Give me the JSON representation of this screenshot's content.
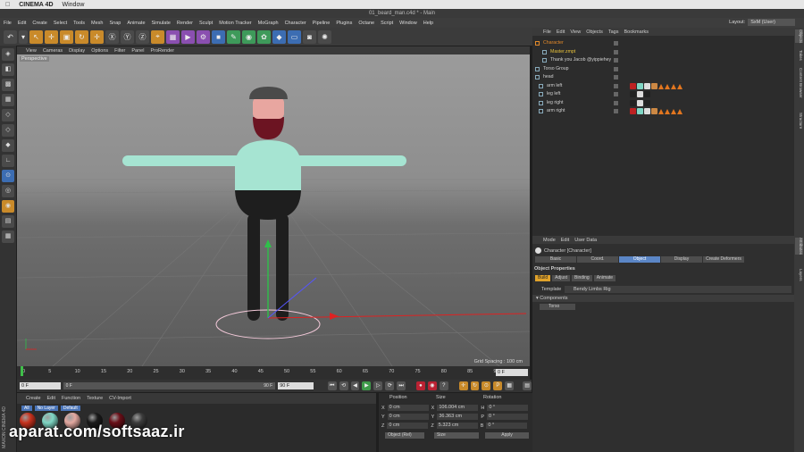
{
  "macbar": {
    "app": "CINEMA 4D",
    "menu": "Window"
  },
  "window_title": "01_beard_man.c4d * - Main",
  "menu": [
    "File",
    "Edit",
    "Create",
    "Select",
    "Tools",
    "Mesh",
    "Snap",
    "Animate",
    "Simulate",
    "Render",
    "Sculpt",
    "Motion Tracker",
    "MoGraph",
    "Character",
    "Pipeline",
    "Plugins",
    "Octane",
    "Script",
    "Window",
    "Help"
  ],
  "layout": {
    "label": "Layout:",
    "value": "SxM (User)"
  },
  "viewport": {
    "menu": [
      "View",
      "Cameras",
      "Display",
      "Options",
      "Filter",
      "Panel",
      "ProRender"
    ],
    "camera": "Perspective",
    "grid_spacing": "Grid Spacing : 100 cm"
  },
  "timeline": {
    "ticks": [
      "0",
      "5",
      "10",
      "15",
      "20",
      "25",
      "30",
      "35",
      "40",
      "45",
      "50",
      "55",
      "60",
      "65",
      "70",
      "75",
      "80",
      "85",
      "90"
    ],
    "current_frame": "0 F",
    "start": "0 F",
    "min": "0 F",
    "max": "90 F",
    "end": "90 F"
  },
  "materials": {
    "menu": [
      "Create",
      "Edit",
      "Function",
      "Texture",
      "CV-Import"
    ],
    "filters": [
      "All",
      "No Layer",
      "Default"
    ],
    "balls": [
      "#c8321e",
      "#7fd6c4",
      "#e3a8a0",
      "#1b1b1b",
      "#6a0f18",
      "#3c3c3c"
    ]
  },
  "coords": {
    "headers": [
      "Position",
      "Size",
      "Rotation"
    ],
    "rows": [
      {
        "axis": "X",
        "pos": "0 cm",
        "size_axis": "X",
        "size": "106.004 cm",
        "rot_axis": "H",
        "rot": "0 °"
      },
      {
        "axis": "Y",
        "pos": "0 cm",
        "size_axis": "Y",
        "size": "36.363 cm",
        "rot_axis": "P",
        "rot": "0 °"
      },
      {
        "axis": "Z",
        "pos": "0 cm",
        "size_axis": "Z",
        "size": "5.323 cm",
        "rot_axis": "B",
        "rot": "0 °"
      }
    ],
    "mode": "Object (Rel)",
    "size_mode": "Size",
    "apply": "Apply"
  },
  "watermark": "aparat.com/softsaaz.ir",
  "maxon": "MAXON CINEMA 4D",
  "object_manager": {
    "menu": [
      "File",
      "Edit",
      "View",
      "Objects",
      "Tags",
      "Bookmarks"
    ],
    "objects": [
      {
        "name": "Character",
        "color": "#e38a2a",
        "indent": 0,
        "tags": []
      },
      {
        "name": "Master.zmpt",
        "color": "#e8c23a",
        "indent": 2,
        "tags": []
      },
      {
        "name": "Thank you Jacob @yippiehey",
        "color": "#cfcfcf",
        "indent": 2,
        "tags": []
      },
      {
        "name": "Torso Group",
        "color": "#cfcfcf",
        "indent": 0,
        "tags": []
      },
      {
        "name": "head",
        "color": "#cfcfcf",
        "indent": 0,
        "tags": []
      },
      {
        "name": "arm left",
        "color": "#cfcfcf",
        "indent": 1,
        "tags": [
          "#b22",
          "#7fd6c4",
          "#ddd",
          "#c84",
          "tri",
          "tri",
          "tri",
          "tri"
        ]
      },
      {
        "name": "leg left",
        "color": "#cfcfcf",
        "indent": 1,
        "tags": [
          "#222",
          "#ddd",
          "#222"
        ]
      },
      {
        "name": "leg right",
        "color": "#cfcfcf",
        "indent": 1,
        "tags": [
          "#222",
          "#ddd",
          "#222"
        ]
      },
      {
        "name": "arm right",
        "color": "#cfcfcf",
        "indent": 1,
        "tags": [
          "#b22",
          "#7fd6c4",
          "#ddd",
          "#c84",
          "tri",
          "tri",
          "tri",
          "tri"
        ]
      }
    ]
  },
  "attributes": {
    "menu": [
      "Mode",
      "Edit",
      "User Data"
    ],
    "object_title": "Character [Character]",
    "tabs": [
      "Basic",
      "Coord.",
      "Object",
      "Display",
      "Create Deformers"
    ],
    "active_tab": "Object",
    "section": "Object Properties",
    "subtabs": [
      "Build",
      "Adjust",
      "Binding",
      "Animate"
    ],
    "template_label": "Template",
    "template_value": "Bendy Limbs Rig",
    "components_label": "Components",
    "component_item": "Torso"
  },
  "right_tabs": [
    "Objects",
    "Takes",
    "Content Browser",
    "Structure",
    "Attributes",
    "Layers"
  ]
}
